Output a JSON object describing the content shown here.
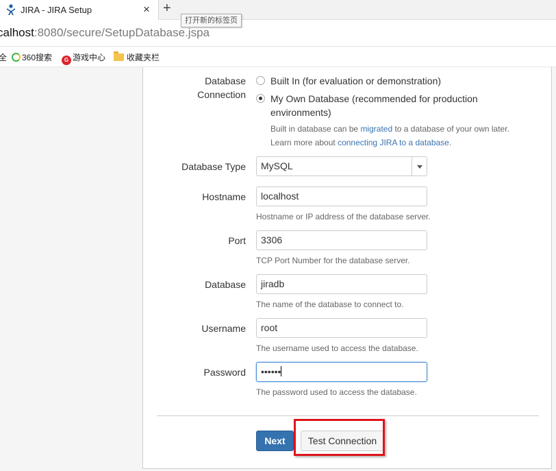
{
  "browser": {
    "tab_title": "JIRA - JIRA Setup",
    "close_glyph": "×",
    "new_tab_glyph": "+",
    "new_tab_tooltip": "打开新的标签页",
    "url_host": "calhost",
    "url_path": ":8080/secure/SetupDatabase.jspa",
    "bookmarks": {
      "cut_item": "全",
      "search_360": "360搜索",
      "game_icon_text": "G",
      "game_center": "游戏中心",
      "favorites_bar": "收藏夹栏"
    }
  },
  "form": {
    "connection": {
      "label_line1": "Database",
      "label_line2": "Connection",
      "option_builtin": "Built In (for evaluation or demonstration)",
      "option_own_line1": "My Own Database (recommended for production",
      "option_own_line2": "environments)",
      "selected": "own",
      "help1_prefix": "Built in database can be ",
      "help1_link": "migrated",
      "help1_suffix": " to a database of your own later.",
      "help2_prefix": "Learn more about ",
      "help2_link": "connecting JIRA to a database",
      "help2_suffix": "."
    },
    "db_type": {
      "label": "Database Type",
      "value": "MySQL"
    },
    "hostname": {
      "label": "Hostname",
      "value": "localhost",
      "help": "Hostname or IP address of the database server."
    },
    "port": {
      "label": "Port",
      "value": "3306",
      "help": "TCP Port Number for the database server."
    },
    "database": {
      "label": "Database",
      "value": "jiradb",
      "help": "The name of the database to connect to."
    },
    "username": {
      "label": "Username",
      "value": "root",
      "help": "The username used to access the database."
    },
    "password": {
      "label": "Password",
      "value": "••••••",
      "help": "The password used to access the database."
    }
  },
  "actions": {
    "next_label": "Next",
    "test_label": "Test Connection"
  },
  "colors": {
    "primary_button": "#3572b0",
    "link": "#3b73af",
    "highlight_box": "#e0141c"
  }
}
